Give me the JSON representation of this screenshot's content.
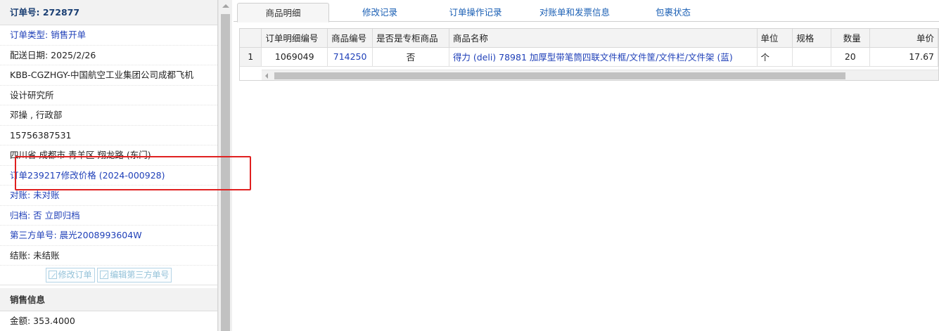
{
  "order": {
    "title_label": "订单号: ",
    "title_value": "272877",
    "rows": [
      "订单类型: 销售开单",
      "配送日期: 2025/2/26",
      "KBB-CGZHGY-中国航空工业集团公司成都飞机",
      "设计研究所",
      "邓操 , 行政部",
      "15756387531",
      "四川省 成都市 青羊区 翔龙路 (东门)",
      "订单239217修改价格 (2024-000928)",
      "对账: 未对账",
      "归档:  否 立即归档",
      "第三方单号: 晨光2008993604W",
      "结账: 未结账"
    ],
    "edit_order_label": "修改订单",
    "edit_third_party_label": "编辑第三方单号"
  },
  "sales": {
    "title": "销售信息",
    "amount": "金额: 353.4000"
  },
  "tabs": [
    "商品明细",
    "修改记录",
    "订单操作记录",
    "对账单和发票信息",
    "包裹状态"
  ],
  "table": {
    "headers": [
      "",
      "订单明细编号",
      "商品编号",
      "是否是专柜商品",
      "商品名称",
      "单位",
      "规格",
      "数量",
      "单价"
    ],
    "rows": [
      [
        "1",
        "1069049",
        "714250",
        "否",
        "得力 (deli)  78981 加厚型带笔筒四联文件框/文件筐/文件栏/文件架 (蓝)",
        "个",
        "",
        "20",
        "17.67"
      ]
    ]
  }
}
